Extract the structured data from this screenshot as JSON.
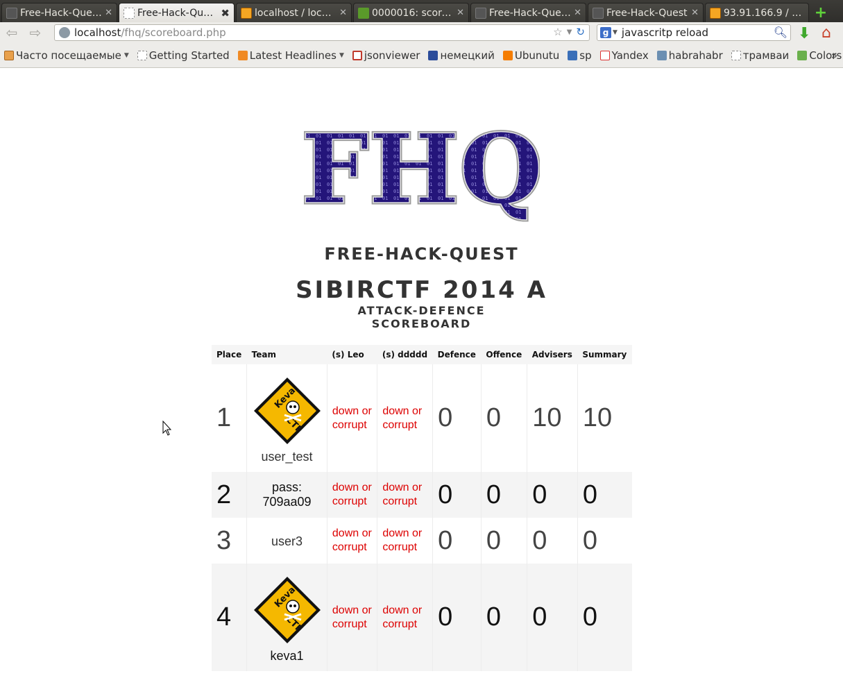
{
  "tabs": [
    {
      "title": "Free-Hack-Quests",
      "favicon": "dark-page-icon",
      "active": false
    },
    {
      "title": "Free-Hack-Quest",
      "favicon": "blank-page-icon",
      "active": true
    },
    {
      "title": "localhost / loca…",
      "favicon": "phpmyadmin-icon",
      "active": false
    },
    {
      "title": "0000016: score…",
      "favicon": "mantis-bug-icon",
      "active": false
    },
    {
      "title": "Free-Hack-Quests",
      "favicon": "dark-page-icon",
      "active": false
    },
    {
      "title": "Free-Hack-Quest",
      "favicon": "dark-page-icon",
      "active": false
    },
    {
      "title": "93.91.166.9 / lo…",
      "favicon": "phpmyadmin-icon",
      "active": false
    }
  ],
  "nav": {
    "url_host": "localhost",
    "url_path": "/fhq/scoreboard.php",
    "search_value": "javascritp reload"
  },
  "bookmarks": [
    {
      "label": "Часто посещаемые",
      "icon": "folder-icon",
      "dropdown": true
    },
    {
      "label": "Getting Started",
      "icon": "page-icon",
      "dropdown": false
    },
    {
      "label": "Latest Headlines",
      "icon": "rss-icon",
      "dropdown": true
    },
    {
      "label": "jsonviewer",
      "icon": "jsonviewer-icon",
      "dropdown": false
    },
    {
      "label": "немецкий",
      "icon": "b-icon",
      "dropdown": false
    },
    {
      "label": "Ubunutu",
      "icon": "blogger-icon",
      "dropdown": false
    },
    {
      "label": "sp",
      "icon": "sp-icon",
      "dropdown": false
    },
    {
      "label": "Yandex",
      "icon": "yandex-icon",
      "dropdown": false
    },
    {
      "label": "habrahabr",
      "icon": "habr-icon",
      "dropdown": false
    },
    {
      "label": "трамваи",
      "icon": "page-icon",
      "dropdown": false
    },
    {
      "label": "Colors",
      "icon": "colors-icon",
      "dropdown": false
    }
  ],
  "page": {
    "logo_text": "FHQ",
    "site_name": "Free-Hack-Quest",
    "event_name": "SibirCTF 2014 A",
    "event_type_line1": "Attack-Defence",
    "event_type_line2": "Scoreboard"
  },
  "scoreboard": {
    "headers": [
      "Place",
      "Team",
      "(s) Leo",
      "(s) ddddd",
      "Defence",
      "Offence",
      "Advisers",
      "Summary"
    ],
    "rows": [
      {
        "place": "1",
        "team": "user_test",
        "logo": true,
        "team_line2": "",
        "leo_1": "down or",
        "leo_2": "corrupt",
        "dd_1": "down or",
        "dd_2": "corrupt",
        "defence": "0",
        "offence": "0",
        "advisers": "10",
        "summary": "10"
      },
      {
        "place": "2",
        "team": "pass:",
        "logo": false,
        "team_line2": "709aa09",
        "leo_1": "down or",
        "leo_2": "corrupt",
        "dd_1": "down or",
        "dd_2": "corrupt",
        "defence": "0",
        "offence": "0",
        "advisers": "0",
        "summary": "0"
      },
      {
        "place": "3",
        "team": "user3",
        "logo": false,
        "team_line2": "",
        "leo_1": "down or",
        "leo_2": "corrupt",
        "dd_1": "down or",
        "dd_2": "corrupt",
        "defence": "0",
        "offence": "0",
        "advisers": "0",
        "summary": "0"
      },
      {
        "place": "4",
        "team": "keva1",
        "logo": true,
        "team_line2": "",
        "leo_1": "down or",
        "leo_2": "corrupt",
        "dd_1": "down or",
        "dd_2": "corrupt",
        "defence": "0",
        "offence": "0",
        "advisers": "0",
        "summary": "0"
      }
    ],
    "team_logo_text_1": "Keva",
    "team_logo_text_2": "CTF",
    "down_color": "#dd0000"
  }
}
